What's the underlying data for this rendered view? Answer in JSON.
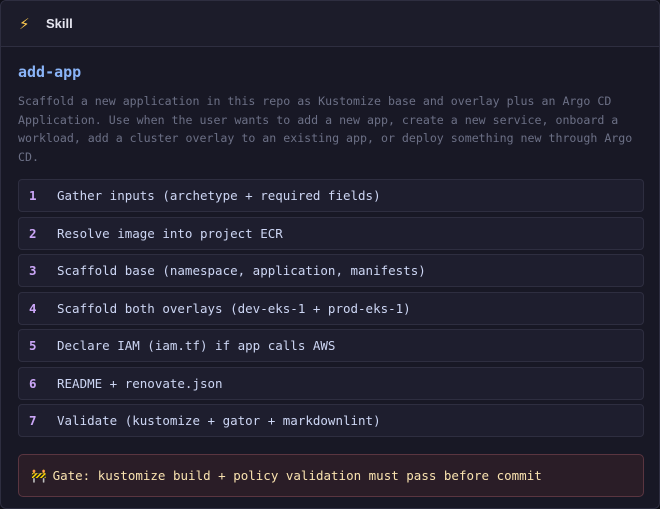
{
  "header": {
    "icon": "lightning-bolt-icon",
    "title": "Skill"
  },
  "skill": {
    "name": "add-app",
    "description": "Scaffold a new application in this repo as Kustomize base and overlay plus an Argo CD Application. Use when the user wants to add a new app, create a new service, onboard a workload, add a cluster overlay to an existing app, or deploy something new through Argo CD."
  },
  "steps": [
    {
      "num": "1",
      "label": "Gather inputs (archetype + required fields)"
    },
    {
      "num": "2",
      "label": "Resolve image into project ECR"
    },
    {
      "num": "3",
      "label": "Scaffold base (namespace, application, manifests)"
    },
    {
      "num": "4",
      "label": "Scaffold both overlays (dev-eks-1 + prod-eks-1)"
    },
    {
      "num": "5",
      "label": "Declare IAM (iam.tf) if app calls AWS"
    },
    {
      "num": "6",
      "label": "README + renovate.json"
    },
    {
      "num": "7",
      "label": "Validate (kustomize + gator + markdownlint)"
    }
  ],
  "gate": {
    "icon": "construction-barrier-icon",
    "text": "Gate: kustomize build + policy validation must pass before commit"
  },
  "colors": {
    "accent": "#8ab4f8",
    "step_number": "#cba6f7",
    "gate_text": "#f9e2af",
    "gate_border": "#5a3540"
  }
}
